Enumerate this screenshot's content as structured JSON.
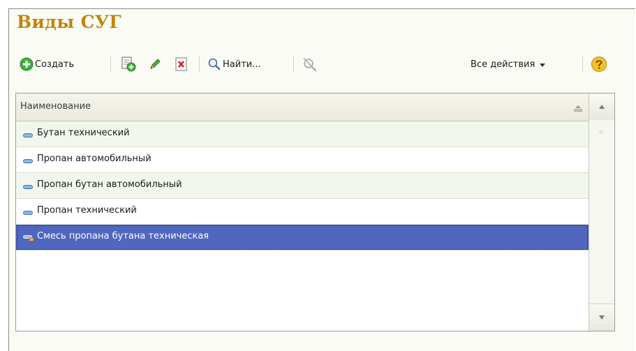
{
  "form": {
    "title": "Виды СУГ"
  },
  "toolbar": {
    "create_label": "Создать",
    "find_label": "Найти...",
    "all_actions_label": "Все действия",
    "icons": {
      "create": "plus-circle-icon",
      "copy": "copy-add-icon",
      "edit": "pencil-icon",
      "delete": "delete-x-icon",
      "find": "magnifier-icon",
      "cancel_search": "cancel-search-icon",
      "dropdown": "chevron-down-icon",
      "help": "help-icon"
    }
  },
  "grid": {
    "column_header": "Наименование",
    "rows": [
      {
        "label": "Бутан технический",
        "icon": "item-minus-icon",
        "selected": false
      },
      {
        "label": "Пропан автомобильный",
        "icon": "item-minus-icon",
        "selected": false
      },
      {
        "label": "Пропан бутан автомобильный",
        "icon": "item-minus-icon",
        "selected": false
      },
      {
        "label": "Пропан технический",
        "icon": "item-minus-icon",
        "selected": false
      },
      {
        "label": "Смесь пропана бутана техническая",
        "icon": "item-edit-icon",
        "selected": true
      }
    ]
  },
  "colors": {
    "title": "#c0860a",
    "selection": "#4f67bf",
    "row_alt": "#f2f7ee",
    "accent_green": "#3fae3f",
    "help_yellow": "#f5c223"
  }
}
